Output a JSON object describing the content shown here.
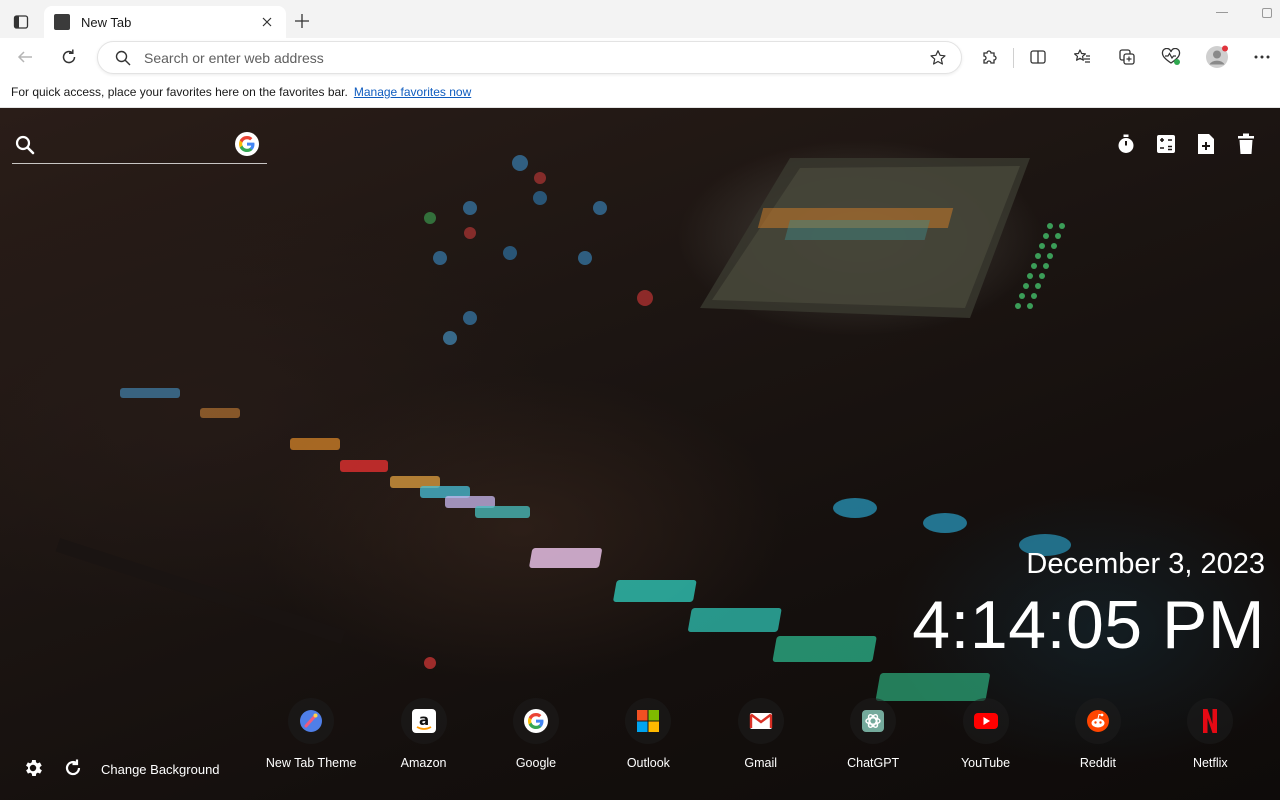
{
  "browser": {
    "tab": {
      "title": "New Tab"
    },
    "address_bar": {
      "placeholder": "Search or enter web address",
      "value": ""
    },
    "favorites_bar": {
      "message": "For quick access, place your favorites here on the favorites bar.",
      "link": "Manage favorites now"
    }
  },
  "newtab": {
    "search": {
      "placeholder": "",
      "engine": "google-icon"
    },
    "clock": {
      "date": "December 3, 2023",
      "time": "4:14:05 PM"
    },
    "bottom": {
      "change_background_label": "Change Background"
    },
    "shortcuts": [
      {
        "label": "New Tab Theme",
        "icon": "new-tab-theme-icon"
      },
      {
        "label": "Amazon",
        "icon": "amazon-icon"
      },
      {
        "label": "Google",
        "icon": "google-icon"
      },
      {
        "label": "Outlook",
        "icon": "outlook-icon"
      },
      {
        "label": "Gmail",
        "icon": "gmail-icon"
      },
      {
        "label": "ChatGPT",
        "icon": "chatgpt-icon"
      },
      {
        "label": "YouTube",
        "icon": "youtube-icon"
      },
      {
        "label": "Reddit",
        "icon": "reddit-icon"
      },
      {
        "label": "Netflix",
        "icon": "netflix-icon"
      }
    ]
  },
  "colors": {
    "link": "#0f5cbf",
    "toolbar_bg": "#ffffff",
    "tabstrip_bg": "#f3f3f3"
  }
}
